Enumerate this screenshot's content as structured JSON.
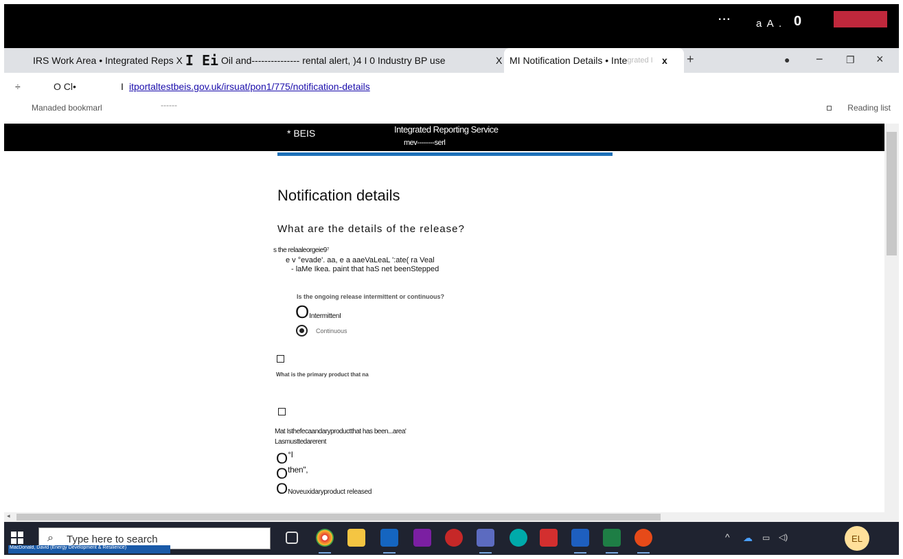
{
  "top": {
    "dots": "···",
    "font_size_label": "a A .",
    "count": "0"
  },
  "tabs": {
    "tab1_prefix": "IRS Work Area • Integrated Reps X",
    "tab1_big": "I Ei",
    "tab1_suffix": "Oil and--------------- rental alert, )4 I 0 Industry BP use",
    "tab1_close": "X",
    "tab2_title": "MI Notification Details • Inte",
    "tab2_fade": "grated I",
    "tab2_close": "x",
    "new_tab": "+",
    "win_profile": "●",
    "win_min": "−",
    "win_max": "❐",
    "win_close": "×"
  },
  "address": {
    "nav": "÷",
    "reload": "O Cl•",
    "sep": "I",
    "url": "itportaltestbeis.gov.uk/irsuat/pon1/775/notification-details"
  },
  "bookmarks": {
    "managed": "Manaded bookmarl",
    "dash": "------",
    "reading_list": "Reading list"
  },
  "site": {
    "logo": "* BEIS",
    "service": "Integrated Reporting Service",
    "sub": "mev--------serl"
  },
  "page": {
    "title": "Notification details",
    "q_release": "What are the details of the release?",
    "source_label": "s the relaaleorgeie9⁷",
    "source_line1": "e v °evade'. aa,         e a aaeVaLeaL ':ate( ra Veal",
    "source_line2": "-   laMe Ikea. paint that haS net beenStepped",
    "q_intermittent": "Is the ongoing release intermittent or continuous?",
    "opt_intermittent": "IntermittenI",
    "opt_continuous": "Continuous",
    "q_primary": "What is the primary product that na",
    "q_secondary": "Mat Isthefecaandaryproductthat has been...area'",
    "q_secondary_hint": "Lasmusttedarerent",
    "opt_o1": "°I",
    "opt_o2": "then\",",
    "opt_o3": "Noveuxidaryproduct released",
    "radio_glyph": "O"
  },
  "taskbar": {
    "search_placeholder": "Type here to search",
    "search_icon": "⌕",
    "tray_up": "^",
    "tray_cloud": "☁",
    "tray_battery": "▭",
    "tray_volume": "◁)",
    "avatar": "EL",
    "user_tag": "MacDonald, David (Energy Development & Resilience)"
  },
  "colors": {
    "brand_blue": "#1d70b8",
    "red": "#c0283c"
  }
}
